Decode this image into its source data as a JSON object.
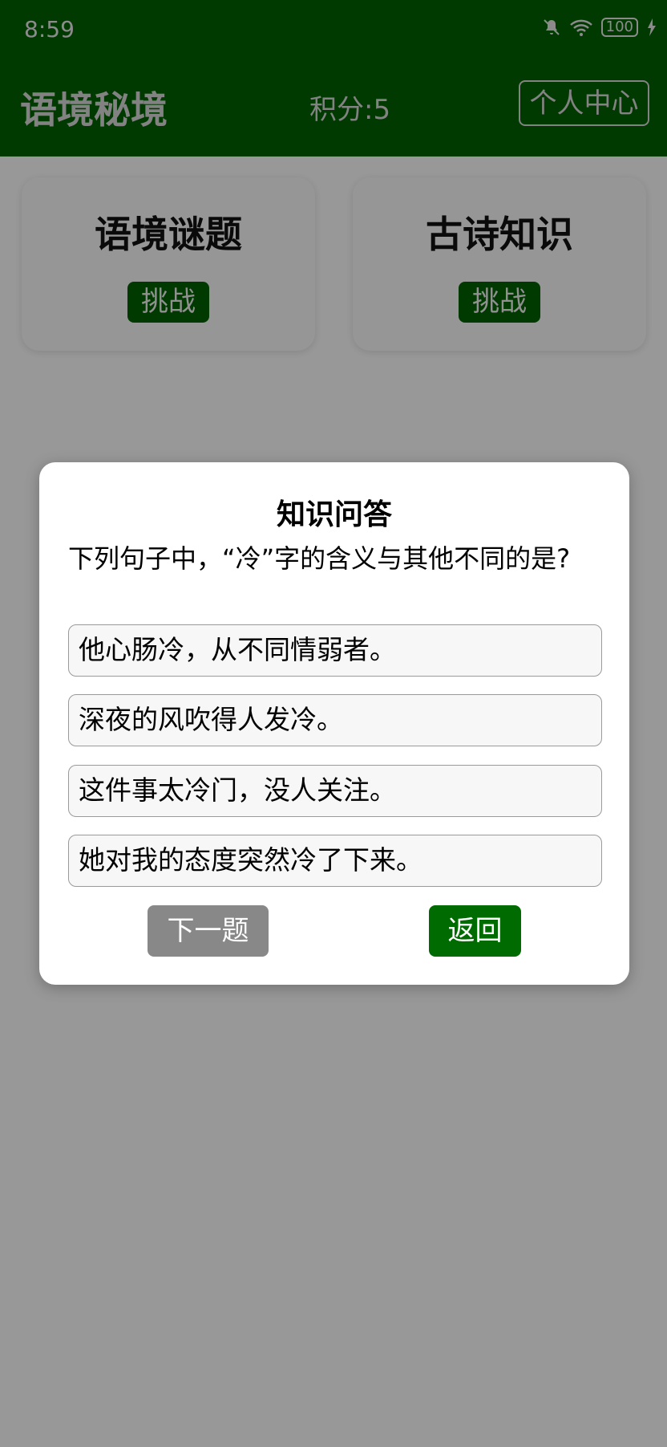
{
  "status_bar": {
    "time": "8:59",
    "battery": "100",
    "icons": [
      "bell-muted-icon",
      "wifi-icon",
      "battery-icon",
      "charging-icon"
    ]
  },
  "app": {
    "title": "语境秘境",
    "score": "积分:5",
    "profile_button": "个人中心"
  },
  "cards": [
    {
      "title": "语境谜题",
      "button": "挑战"
    },
    {
      "title": "古诗知识",
      "button": "挑战"
    }
  ],
  "modal": {
    "title": "知识问答",
    "question": "下列句子中，“冷”字的含义与其他不同的是?",
    "options": [
      "他心肠冷，从不同情弱者。",
      "深夜的风吹得人发冷。",
      "这件事太冷门，没人关注。",
      "她对我的态度突然冷了下来。"
    ],
    "next_button": "下一题",
    "back_button": "返回"
  },
  "colors": {
    "primary_green": "#006100",
    "button_gray": "#888888",
    "overlay": "rgba(0,0,0,0.40)"
  }
}
